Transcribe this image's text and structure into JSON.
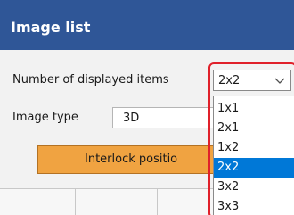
{
  "window": {
    "title": "Image list"
  },
  "display_items": {
    "label": "Number of displayed items",
    "selected_value": "2x2",
    "options": [
      "1x1",
      "2x1",
      "1x2",
      "2x2",
      "3x2",
      "3x3"
    ],
    "highlighted_index": 3
  },
  "image_type": {
    "label": "Image type",
    "value": "3D"
  },
  "interlock_button": {
    "label": "Interlock positio"
  },
  "icons": {
    "dropdown": "chevron-down-icon"
  },
  "colors": {
    "title_bar": "#2f5697",
    "button_orange": "#f0a341",
    "selection_blue": "#0078d7",
    "annotation_red": "#e0202a"
  }
}
